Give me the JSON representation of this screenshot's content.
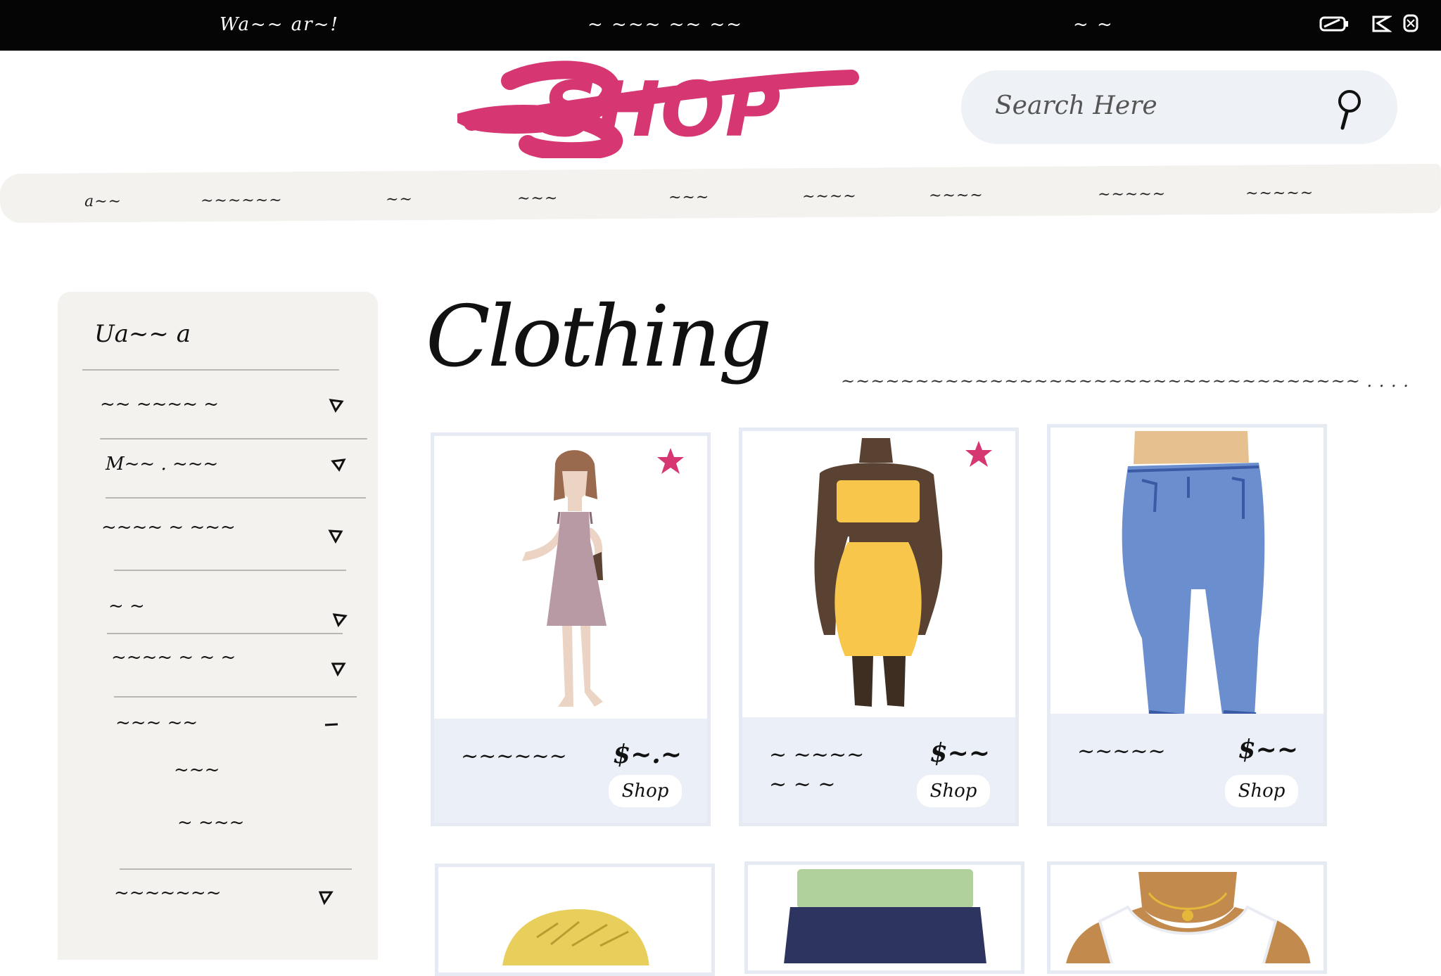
{
  "status_bar": {
    "left_text": "Wa~~ ar~!",
    "center_text": "~ ~~~ ~~ ~~",
    "right_text": "~ ~",
    "icons": [
      "battery-icon",
      "wifi-icon",
      "signal-icon"
    ]
  },
  "header": {
    "logo_text": "SHOP",
    "logo_color": "#d63773",
    "search": {
      "placeholder": "Search Here"
    }
  },
  "nav": {
    "items": [
      "a~~",
      "~~~~~~",
      "~~",
      "~~~",
      "~~~",
      "~~~~",
      "~~~~",
      "~~~~~",
      "~~~~~"
    ]
  },
  "sidebar": {
    "title": "Ua~~ a",
    "items": [
      {
        "label": "~~ ~~~~ ~",
        "marker": "chevron-icon"
      },
      {
        "label": "M~~ . ~~~",
        "marker": "chevron-icon"
      },
      {
        "label": "~~~~ ~ ~~~",
        "marker": "chevron-icon"
      },
      {
        "label": "~ ~",
        "marker": "chevron-icon"
      },
      {
        "label": "~~~~ ~ ~ ~",
        "marker": "chevron-icon"
      },
      {
        "label": "~~~ ~~",
        "marker": "minus-icon"
      },
      {
        "label": "~~~",
        "marker": ""
      },
      {
        "label": "~ ~~~",
        "marker": ""
      },
      {
        "label": "~~~~~~~",
        "marker": "chevron-icon"
      }
    ]
  },
  "main": {
    "heading": "Clothing",
    "subheading": "~~~~~~~~~~~~~~~~~~~~~~~~~~~~~~~~~~~ . . . ."
  },
  "products": [
    {
      "name": "~~~~~~",
      "price": "$~.~",
      "button": "Shop",
      "favorite": true,
      "image": "pink-dress"
    },
    {
      "name": "~ ~~~~",
      "subname": "~ ~ ~",
      "price": "$~~",
      "button": "Shop",
      "favorite": true,
      "image": "yellow-two-piece"
    },
    {
      "name": "~~~~~",
      "price": "$~~",
      "button": "Shop",
      "favorite": false,
      "image": "blue-jeans"
    },
    {
      "name": "",
      "price": "",
      "button": "",
      "favorite": false,
      "image": "straw-hat"
    },
    {
      "name": "",
      "price": "",
      "button": "",
      "favorite": false,
      "image": "navy-skirt"
    },
    {
      "name": "",
      "price": "",
      "button": "",
      "favorite": false,
      "image": "white-top"
    }
  ],
  "colors": {
    "accent": "#d63773",
    "nav_bg": "#f4f2ef",
    "card_footer": "#ebeff7",
    "search_bg": "#eef1f6"
  }
}
